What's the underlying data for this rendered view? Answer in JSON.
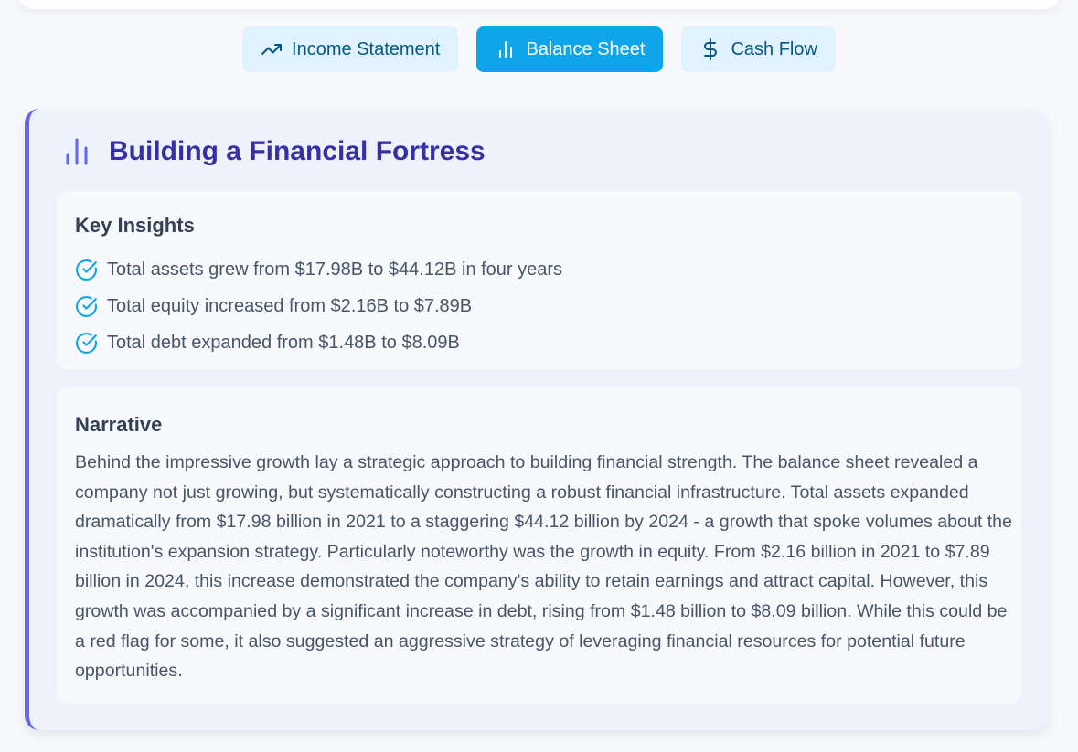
{
  "tabs": [
    {
      "label": "Income Statement",
      "icon": "trending-up-icon",
      "active": false
    },
    {
      "label": "Balance Sheet",
      "icon": "bar-chart-icon",
      "active": true
    },
    {
      "label": "Cash Flow",
      "icon": "dollar-sign-icon",
      "active": false
    }
  ],
  "card": {
    "title": "Building a Financial Fortress",
    "icon": "bar-chart-icon",
    "accent_color": "#6366f1",
    "title_color": "#3730a3"
  },
  "insights": {
    "heading": "Key Insights",
    "icon": "check-circle-icon",
    "items": [
      "Total assets grew from $17.98B to $44.12B in four years",
      "Total equity increased from $2.16B to $7.89B",
      "Total debt expanded from $1.48B to $8.09B"
    ]
  },
  "narrative": {
    "heading": "Narrative",
    "text": "Behind the impressive growth lay a strategic approach to building financial strength. The balance sheet revealed a company not just growing, but systematically constructing a robust financial infrastructure. Total assets expanded dramatically from $17.98 billion in 2021 to a staggering $44.12 billion by 2024 - a growth that spoke volumes about the institution's expansion strategy. Particularly noteworthy was the growth in equity. From $2.16 billion in 2021 to $7.89 billion in 2024, this increase demonstrated the company's ability to retain earnings and attract capital. However, this growth was accompanied by a significant increase in debt, rising from $1.48 billion to $8.09 billion. While this could be a red flag for some, it also suggested an aggressive strategy of leveraging financial resources for potential future opportunities."
  },
  "colors": {
    "active_tab": "#0ea5e9",
    "inactive_tab": "#e0f2fe",
    "check_icon": "#0ea5e9"
  }
}
